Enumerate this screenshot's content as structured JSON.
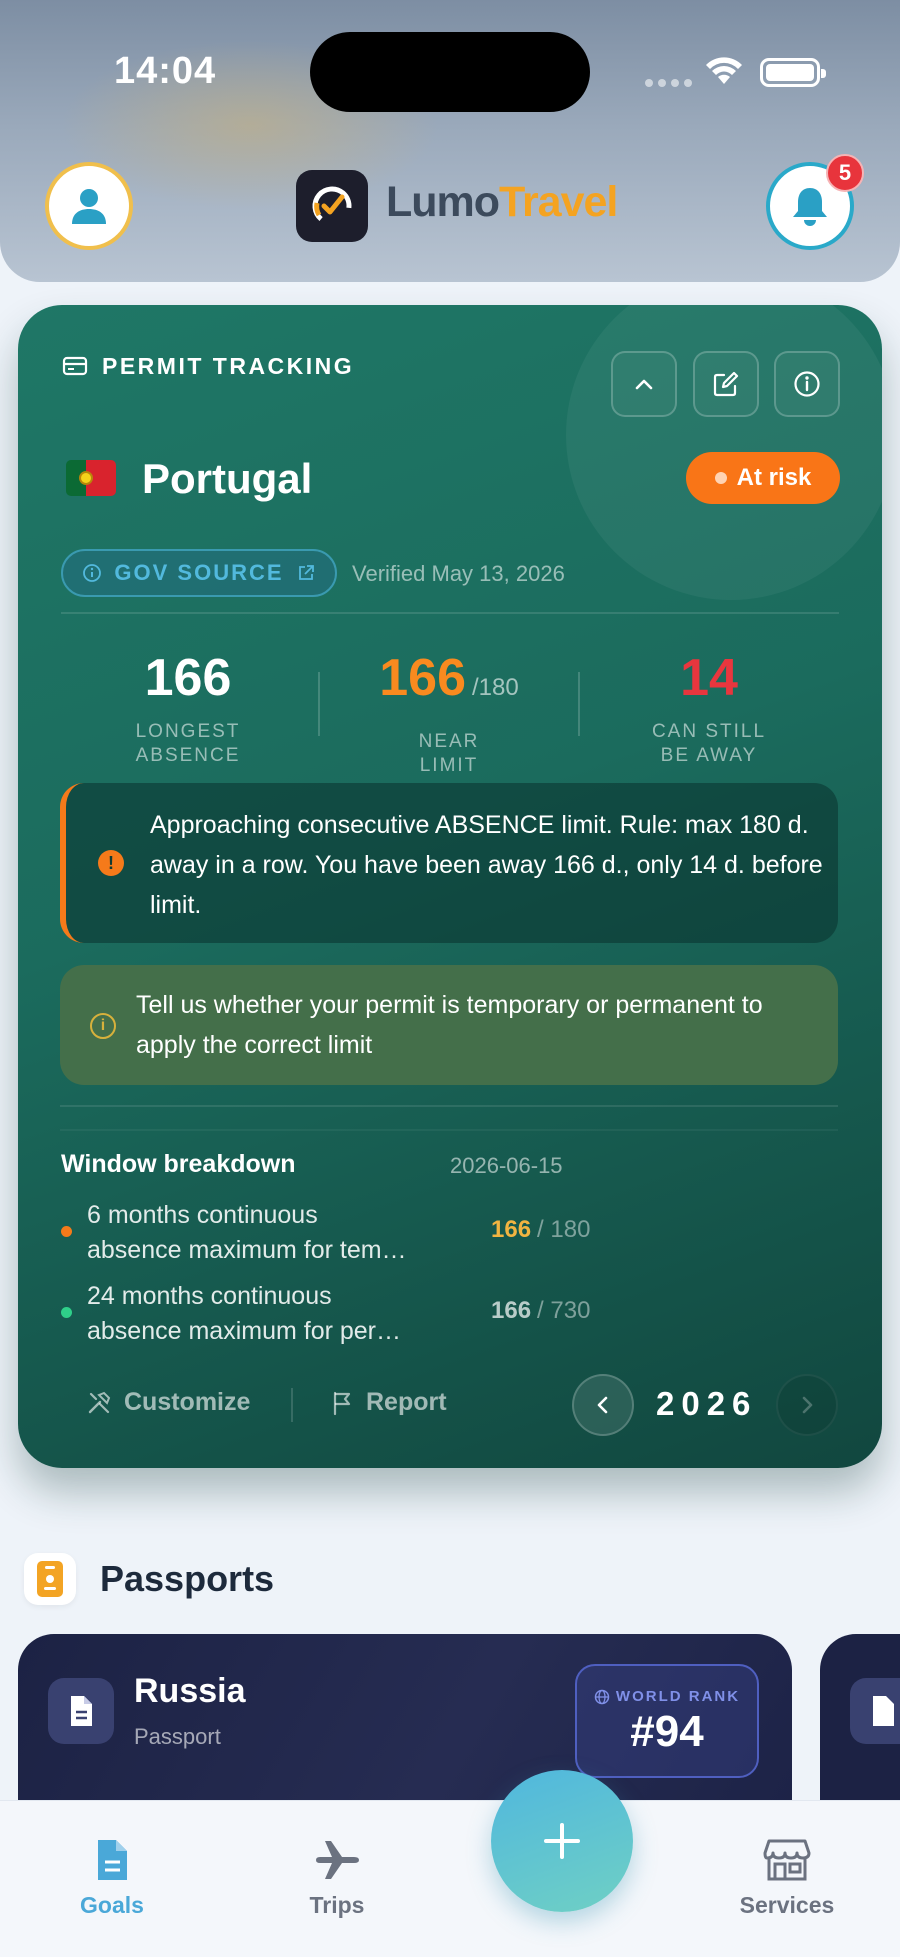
{
  "status_bar": {
    "time": "14:04"
  },
  "header": {
    "brand_part1": "Lumo",
    "brand_part2": "Travel",
    "notification_count": "5"
  },
  "permit": {
    "section_label": "PERMIT TRACKING",
    "country": "Portugal",
    "status": "At risk",
    "gov_source_label": "GOV SOURCE",
    "verified_text": "Verified May 13, 2026",
    "stats": [
      {
        "value": "166",
        "suffix": "",
        "label_line1": "LONGEST",
        "label_line2": "ABSENCE",
        "color": "#ffffff"
      },
      {
        "value": "166",
        "suffix": "/180",
        "label_line1": "NEAR",
        "label_line2": "LIMIT",
        "color": "#f98a1f"
      },
      {
        "value": "14",
        "suffix": "",
        "label_line1": "CAN STILL",
        "label_line2": "BE AWAY",
        "color": "#e8363e"
      }
    ],
    "warning": "Approaching consecutive ABSENCE limit. Rule: max 180 d. away in a row. You have been away 166 d., only 14 d. before limit.",
    "info": "Tell us whether your permit is temporary or permanent to apply the correct limit",
    "breakdown": {
      "title": "Window breakdown",
      "date": "2026-06-15",
      "rows": [
        {
          "line1": "6 months continuous",
          "line2": "absence maximum for tem…",
          "value": "166",
          "limit": "/ 180",
          "dot_color": "#f57a1a",
          "value_color": "#f2b441"
        },
        {
          "line1": "24 months continuous",
          "line2": "absence maximum for per…",
          "value": "166",
          "limit": "/ 730",
          "dot_color": "#2fd08a",
          "value_color": "rgba(255,255,255,0.7)"
        }
      ]
    },
    "footer": {
      "customize": "Customize",
      "report": "Report",
      "year": "2026"
    }
  },
  "passports": {
    "title": "Passports",
    "cards": [
      {
        "country": "Russia",
        "type": "Passport",
        "rank_label": "WORLD RANK",
        "rank": "#94"
      }
    ]
  },
  "nav": {
    "goals": "Goals",
    "trips": "Trips",
    "services": "Services",
    "active_color": "#4aa8d8",
    "inactive_color": "#6b7280"
  }
}
